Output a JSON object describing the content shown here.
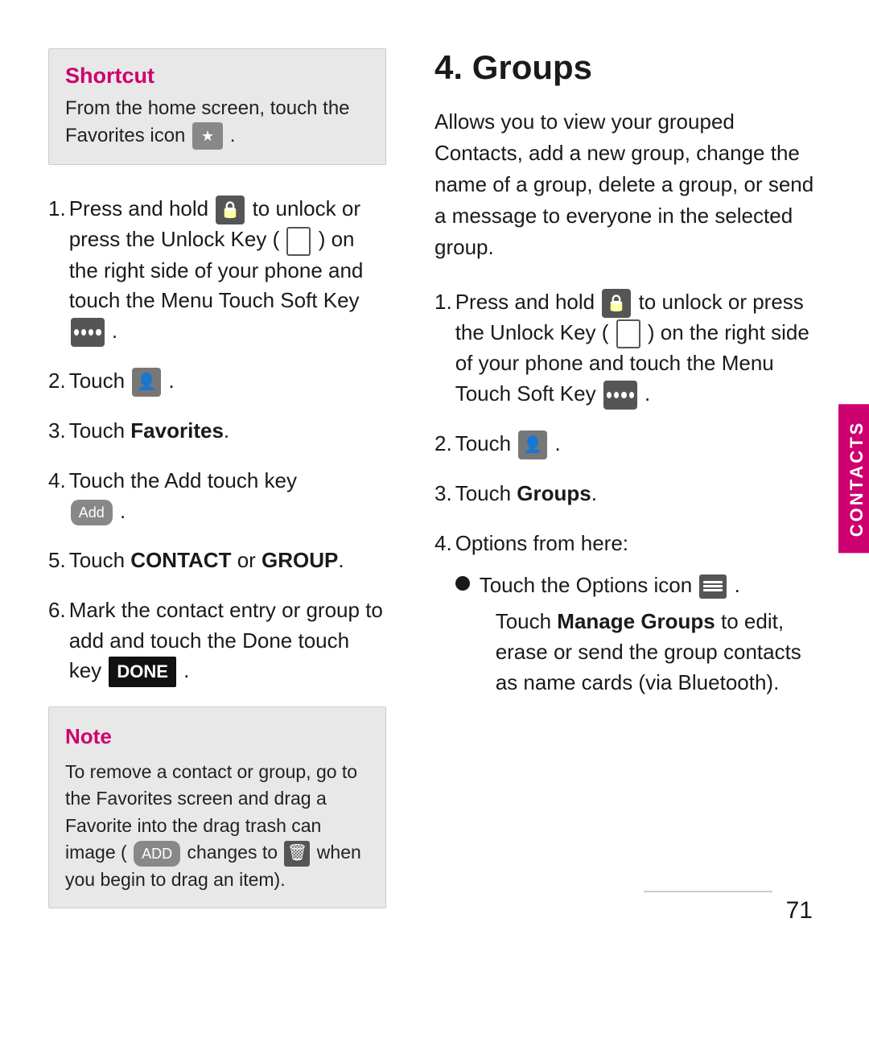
{
  "shortcut": {
    "title": "Shortcut",
    "text": "From the home screen, touch the Favorites icon"
  },
  "left_steps": [
    {
      "number": "1.",
      "text_parts": [
        "Press and hold",
        " to unlock or press the Unlock Key (",
        ") on the right side of your phone and touch the Menu Touch Soft Key",
        "."
      ]
    },
    {
      "number": "2.",
      "text_parts": [
        "Touch",
        "."
      ]
    },
    {
      "number": "3.",
      "text_bold": "Favorites",
      "prefix": "Touch "
    },
    {
      "number": "4.",
      "text": "Touch the Add touch key"
    },
    {
      "number": "5.",
      "text_parts": [
        "Touch "
      ],
      "bold_parts": [
        "CONTACT",
        " or ",
        "GROUP"
      ],
      "suffix": "."
    },
    {
      "number": "6.",
      "text": "Mark the contact entry or group to add and touch the Done touch key",
      "has_done": true
    }
  ],
  "note": {
    "title": "Note",
    "text": "To remove a contact or group, go to the Favorites screen and drag a Favorite into the drag trash can image (",
    "text2": "changes to",
    "text3": "when you begin to drag an item)."
  },
  "right_section": {
    "heading": "4. Groups",
    "intro": "Allows you to view your grouped Contacts, add a new group, change the name of a group, delete a group, or send a message to everyone in the selected group.",
    "steps": [
      {
        "number": "1.",
        "text_parts": [
          "Press and hold",
          " to unlock or press the Unlock Key (",
          ") on the right side of your phone and touch the Menu Touch Soft Key",
          "."
        ]
      },
      {
        "number": "2.",
        "text_parts": [
          "Touch",
          "."
        ]
      },
      {
        "number": "3.",
        "prefix": "Touch ",
        "text_bold": "Groups",
        "suffix": "."
      },
      {
        "number": "4.",
        "text": "Options from here:",
        "bullets": [
          {
            "text_parts": [
              "Touch the Options icon",
              "."
            ],
            "sub": [
              "Touch ",
              "Manage Groups",
              " to edit, erase or send the group contacts as name cards (via Bluetooth)."
            ]
          }
        ]
      }
    ]
  },
  "contacts_tab": "CONTACTS",
  "page_number": "71"
}
